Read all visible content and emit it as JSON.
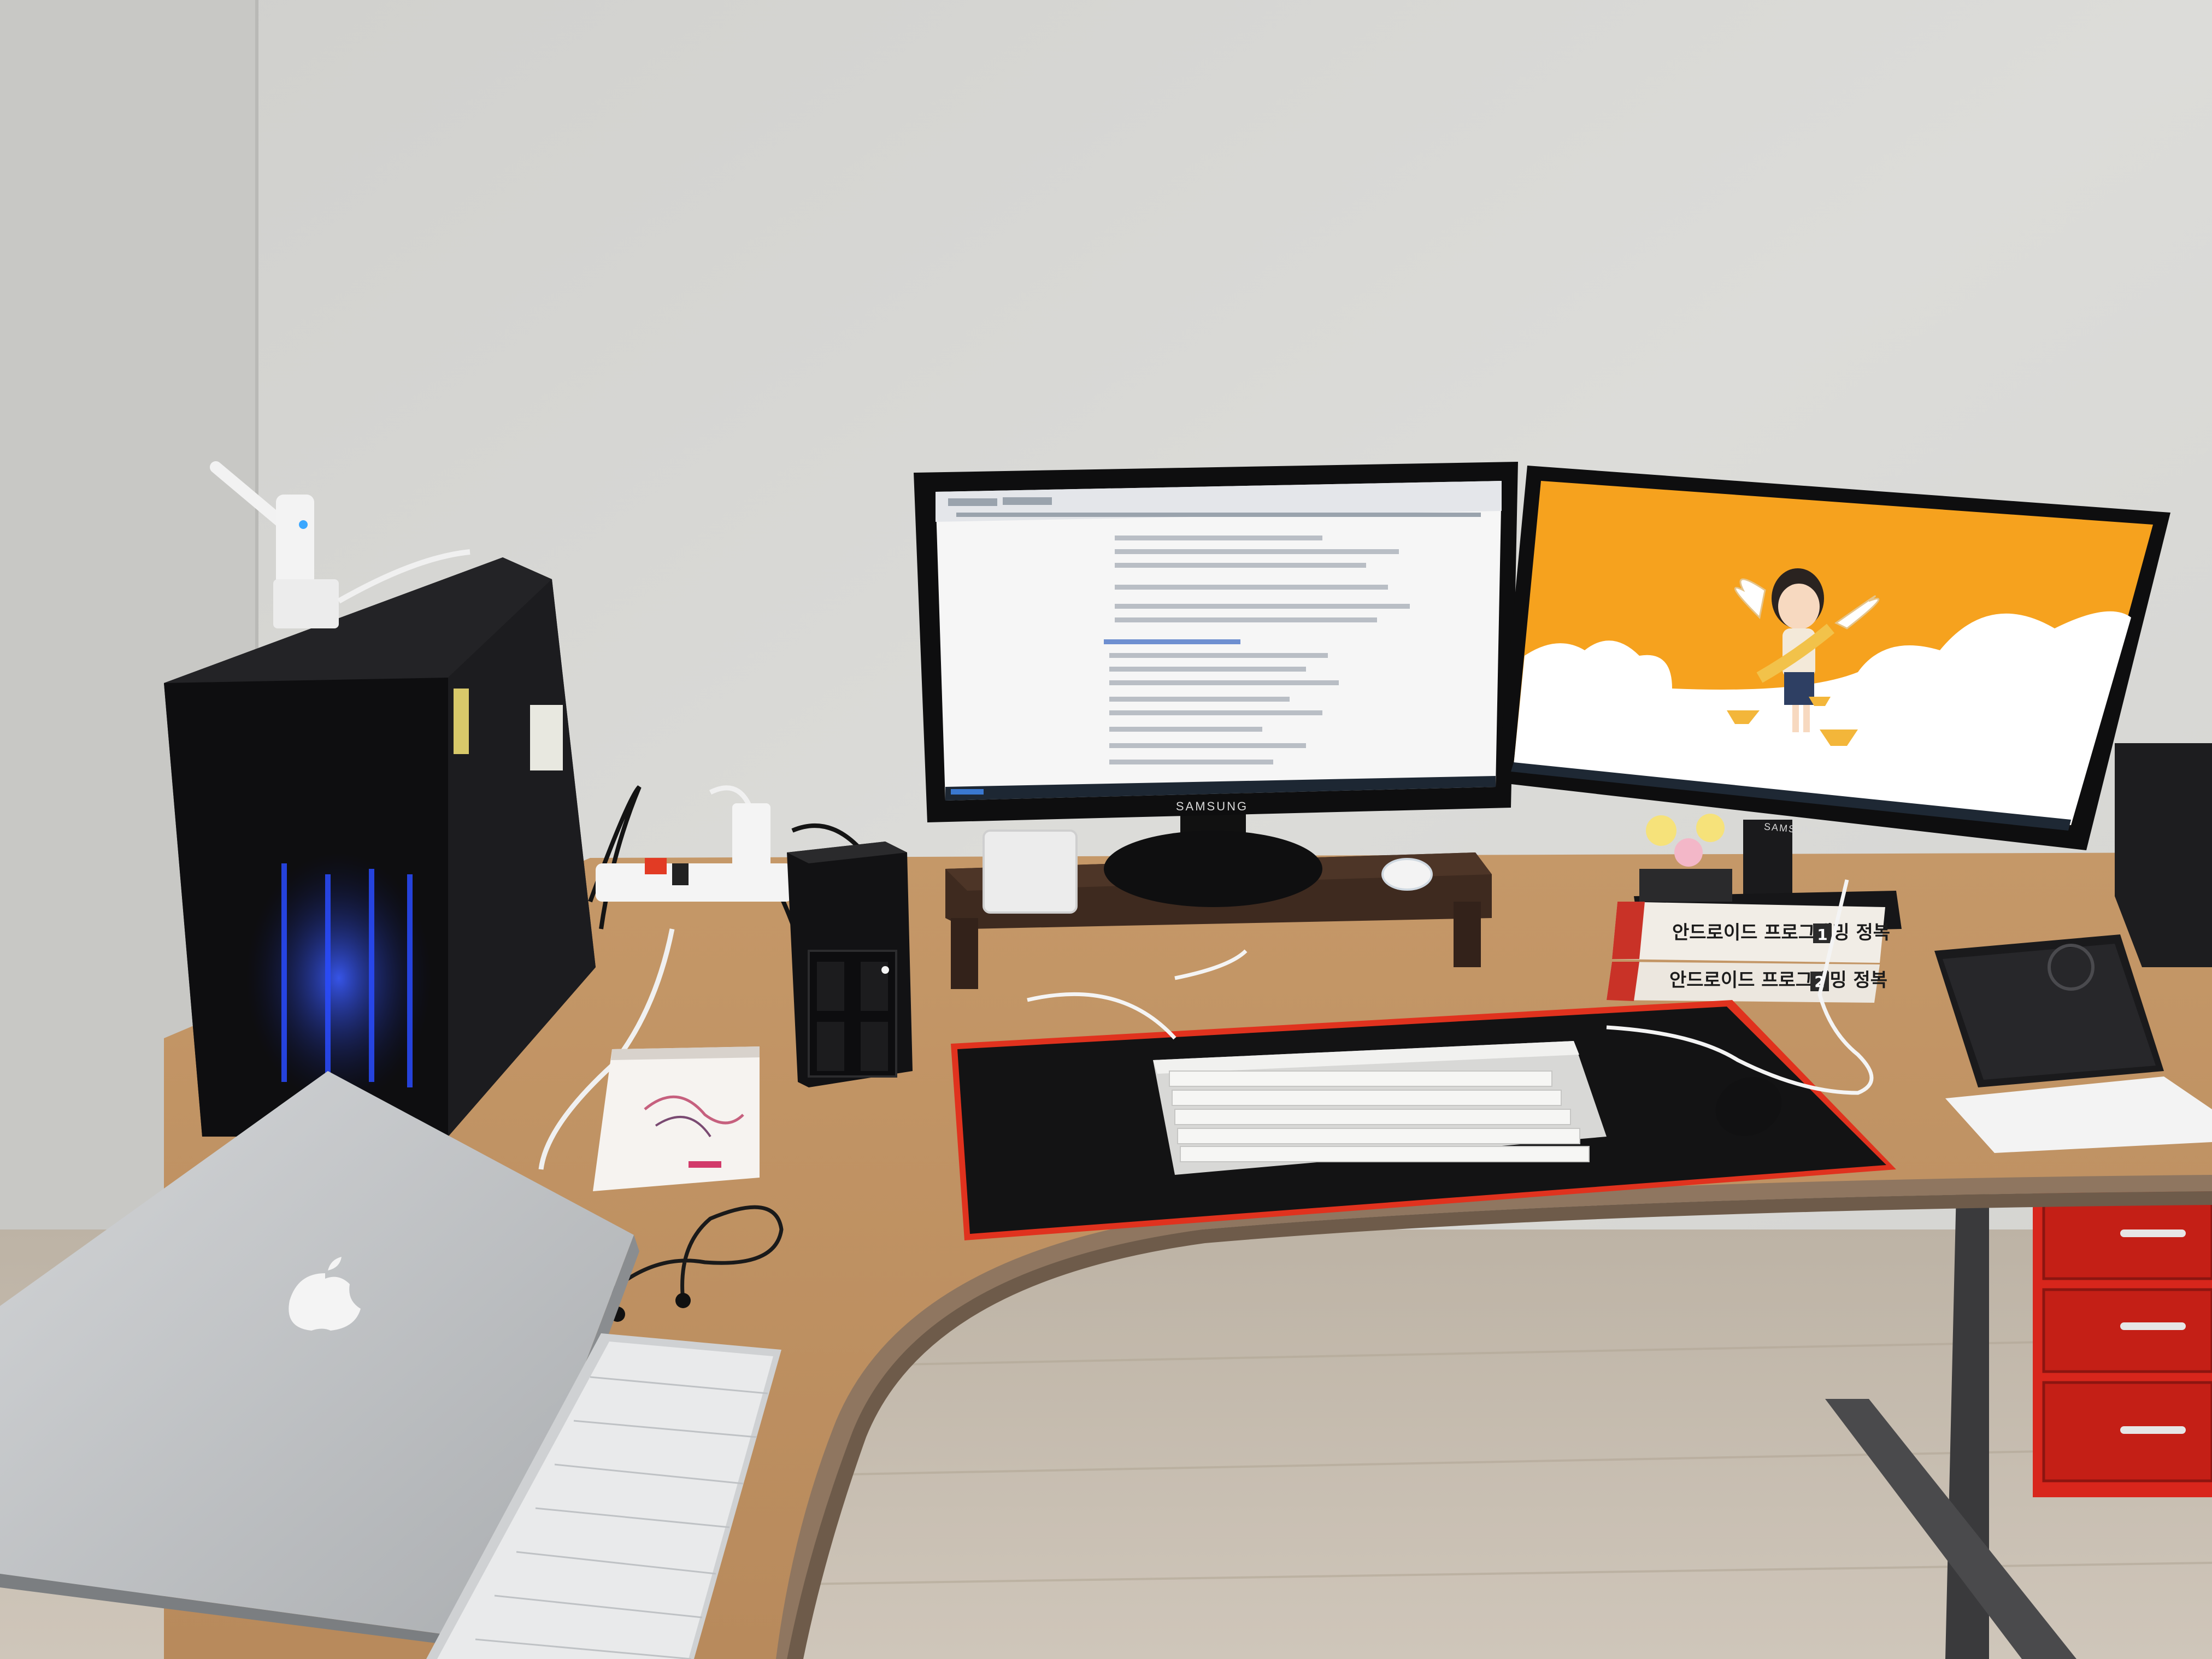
{
  "scene": {
    "left_monitor": {
      "brand": "SAMSUNG",
      "screen": "browser document"
    },
    "right_monitor": {
      "brand": "SAMSUNG",
      "screen": "orange wallpaper with winged character"
    },
    "books": {
      "top_title": "안드로이드 프로그래밍 정복",
      "top_volume": "1",
      "bottom_title": "안드로이드 프로그래밍 정복",
      "bottom_volume": "2"
    },
    "colors": {
      "wall": "#d9d9d6",
      "desk": "#c99a6a",
      "mouse_pad_border": "#e0321e",
      "wallpaper_orange": "#f6a21e",
      "drawer_red": "#d8261c"
    }
  }
}
